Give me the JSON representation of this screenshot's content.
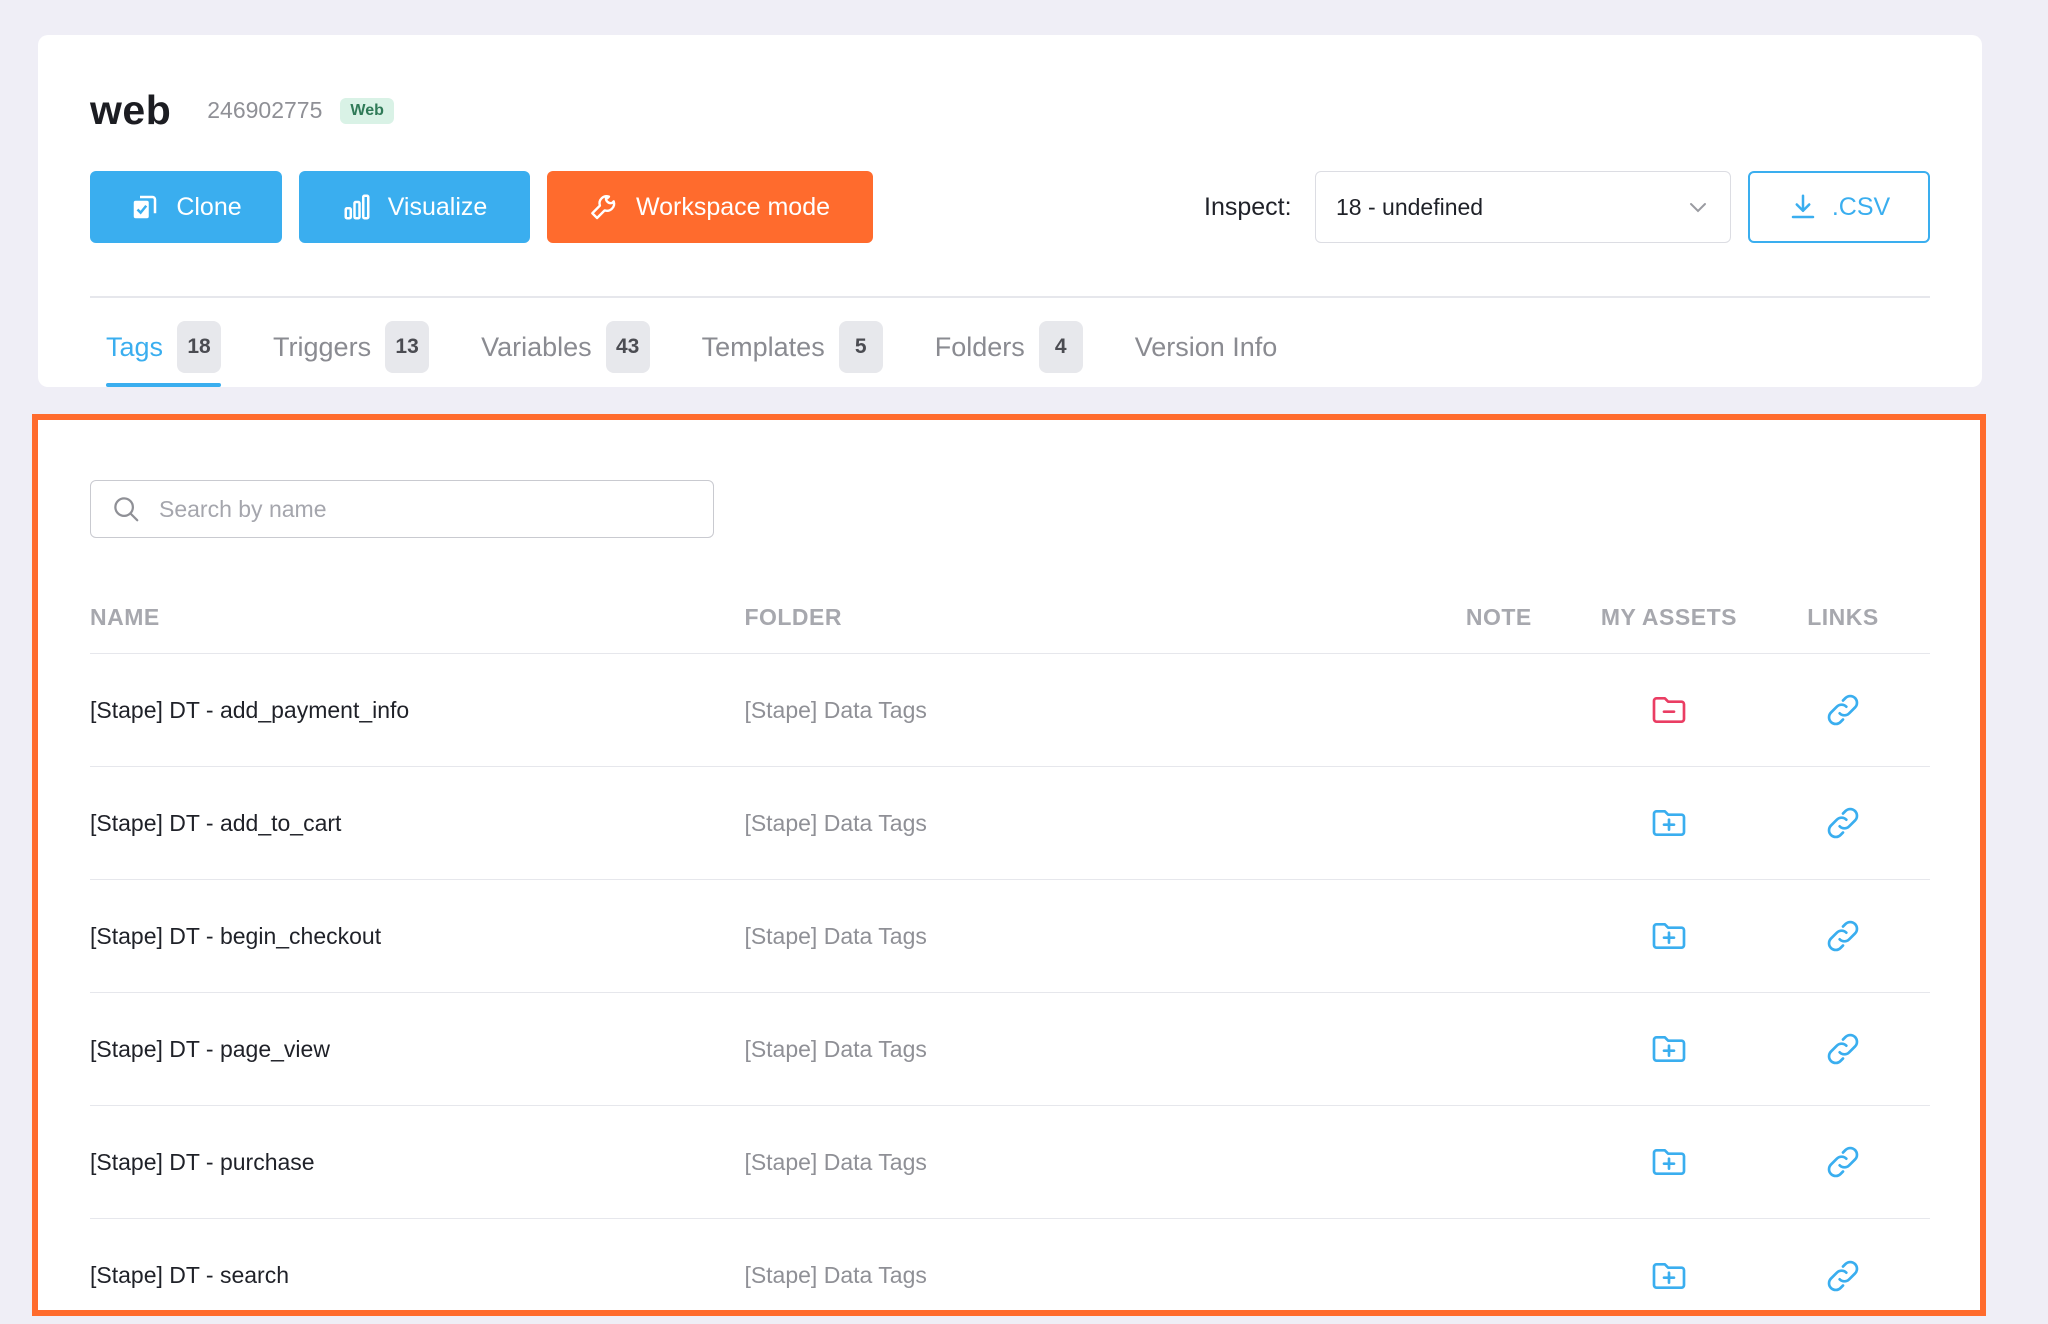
{
  "container": {
    "name": "web",
    "id": "246902775",
    "badge": "Web"
  },
  "toolbar": {
    "clone_label": "Clone",
    "visualize_label": "Visualize",
    "workspace_label": "Workspace mode",
    "inspect_label": "Inspect:",
    "inspect_value": "18 - undefined",
    "csv_label": ".CSV"
  },
  "tabs": [
    {
      "label": "Tags",
      "count": "18",
      "active": true
    },
    {
      "label": "Triggers",
      "count": "13"
    },
    {
      "label": "Variables",
      "count": "43"
    },
    {
      "label": "Templates",
      "count": "5"
    },
    {
      "label": "Folders",
      "count": "4"
    },
    {
      "label": "Version Info"
    }
  ],
  "search": {
    "placeholder": "Search by name",
    "value": ""
  },
  "table": {
    "headers": {
      "name": "NAME",
      "folder": "FOLDER",
      "note": "NOTE",
      "assets": "MY ASSETS",
      "links": "LINKS"
    },
    "rows": [
      {
        "name": "[Stape] DT - add_payment_info",
        "folder": "[Stape] Data Tags",
        "asset_icon": "folder-minus-icon"
      },
      {
        "name": "[Stape] DT - add_to_cart",
        "folder": "[Stape] Data Tags",
        "asset_icon": "folder-plus-icon"
      },
      {
        "name": "[Stape] DT - begin_checkout",
        "folder": "[Stape] Data Tags",
        "asset_icon": "folder-plus-icon"
      },
      {
        "name": "[Stape] DT - page_view",
        "folder": "[Stape] Data Tags",
        "asset_icon": "folder-plus-icon"
      },
      {
        "name": "[Stape] DT - purchase",
        "folder": "[Stape] Data Tags",
        "asset_icon": "folder-plus-icon"
      },
      {
        "name": "[Stape] DT - search",
        "folder": "[Stape] Data Tags",
        "asset_icon": "folder-plus-icon"
      }
    ]
  },
  "colors": {
    "primary": "#3aaeef",
    "accent": "#ff6b2d",
    "danger": "#ea3d63",
    "badge_bg": "#d9f2e6"
  }
}
